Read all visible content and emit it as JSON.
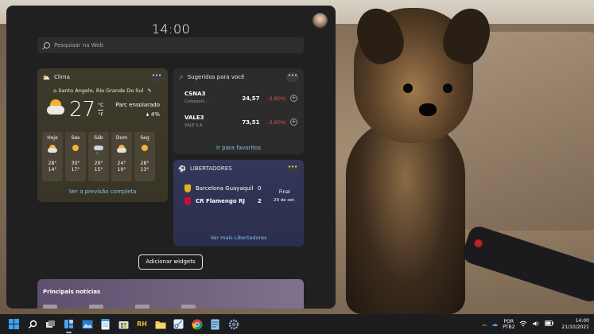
{
  "panel": {
    "clock": "14:00",
    "search_placeholder": "Pesquisar na Web"
  },
  "weather": {
    "title": "Clima",
    "location": "Santo Angelo, Rio Grande Do Sul",
    "temperature": "27",
    "unit_c": "°C",
    "unit_f": "°F",
    "condition": "Parc ensolarado",
    "precip": "4%",
    "forecast": [
      {
        "day": "Hoje",
        "icon": "partly-sunny-icon",
        "high": "28°",
        "low": "14°"
      },
      {
        "day": "Sex",
        "icon": "sunny-icon",
        "high": "30°",
        "low": "17°"
      },
      {
        "day": "Sáb",
        "icon": "rain-icon",
        "high": "20°",
        "low": "15°"
      },
      {
        "day": "Dom",
        "icon": "partly-sunny-icon",
        "high": "24°",
        "low": "10°"
      },
      {
        "day": "Seg",
        "icon": "sunny-icon",
        "high": "28°",
        "low": "13°"
      }
    ],
    "link": "Ver a previsão completa"
  },
  "stocks": {
    "title": "Sugeridos para você",
    "items": [
      {
        "symbol": "CSNA3",
        "company": "Companhi...",
        "price": "24,57",
        "change": "-3,80%"
      },
      {
        "symbol": "VALE3",
        "company": "VALE S.A.",
        "price": "73,51",
        "change": "-3,80%"
      }
    ],
    "link": "Ir para favoritos",
    "change_color": "#e25040"
  },
  "sports": {
    "title": "LIBERTADORES",
    "teams": [
      {
        "name": "Barcelona Guayaquil",
        "score": "0",
        "crest_color": "#e3b21f"
      },
      {
        "name": "CR Flamengo RJ",
        "score": "2",
        "crest_color": "#c8102e"
      }
    ],
    "status": "Final",
    "date": "29 de set.",
    "link": "Ver mais Libertadores"
  },
  "add_widgets_label": "Adicionar widgets",
  "news": {
    "title": "Principais notícias"
  },
  "taskbar": {
    "apps": [
      "start-icon",
      "search-icon",
      "task-view-icon",
      "widgets-icon",
      "photos-icon",
      "notepad-icon",
      "store-icon",
      "rh-app-icon",
      "file-explorer-icon",
      "snipping-tool-icon",
      "chrome-icon",
      "notepad-plus-icon",
      "settings-icon"
    ],
    "rh_label": "RH",
    "lang_top": "POR",
    "lang_bottom": "PTB2",
    "time": "14:00",
    "date": "21/10/2021"
  }
}
